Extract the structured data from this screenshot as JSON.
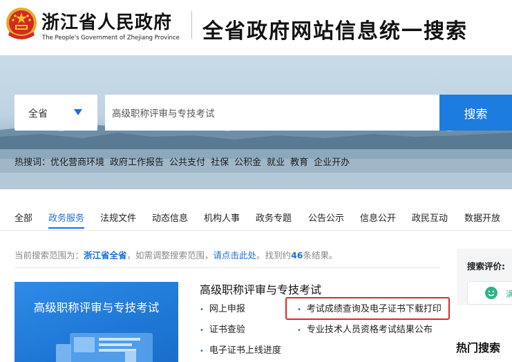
{
  "header": {
    "title_cn": "浙江省人民政府",
    "title_en": "The People's Government of Zhejiang Province",
    "portal_title": "全省政府网站信息统一搜索"
  },
  "search": {
    "scope": "全省",
    "query": "高级职称评审与专技考试",
    "button_label": "搜索"
  },
  "hot_search": {
    "label": "热搜词：",
    "items": [
      "优化营商环境",
      "政府工作报告",
      "公共支付",
      "社保",
      "公积金",
      "就业",
      "教育",
      "企业开办"
    ]
  },
  "tabs": [
    {
      "label": "全部",
      "active": false
    },
    {
      "label": "政务服务",
      "active": true
    },
    {
      "label": "法规文件",
      "active": false
    },
    {
      "label": "动态信息",
      "active": false
    },
    {
      "label": "机构人事",
      "active": false
    },
    {
      "label": "政务专题",
      "active": false
    },
    {
      "label": "公告公示",
      "active": false
    },
    {
      "label": "信息公开",
      "active": false
    },
    {
      "label": "政民互动",
      "active": false
    },
    {
      "label": "数据开放",
      "active": false
    }
  ],
  "result_info": {
    "prefix": "当前搜索范围为：",
    "scope": "浙江省全省",
    "middle": "，如需调整搜索范围，",
    "link": "请点击此处",
    "suffix1": "。找到约",
    "count": "46",
    "suffix2": "条结果。"
  },
  "result": {
    "thumb_title": "高级职称评审与专技考试",
    "title": "高级职称评审与专技考试",
    "links": [
      "网上申报",
      "考试成绩查询及电子证书下载打印",
      "证书查验",
      "专业技术人员资格考试结果公布",
      "电子证书上线进度"
    ]
  },
  "sidebar": {
    "rate_label": "搜索评价:",
    "rate_text": "满",
    "hot_heading": "热门搜索"
  },
  "colors": {
    "accent": "#1c7ce0",
    "highlight_box": "#d9262c",
    "rate_green": "#2fb38a"
  }
}
